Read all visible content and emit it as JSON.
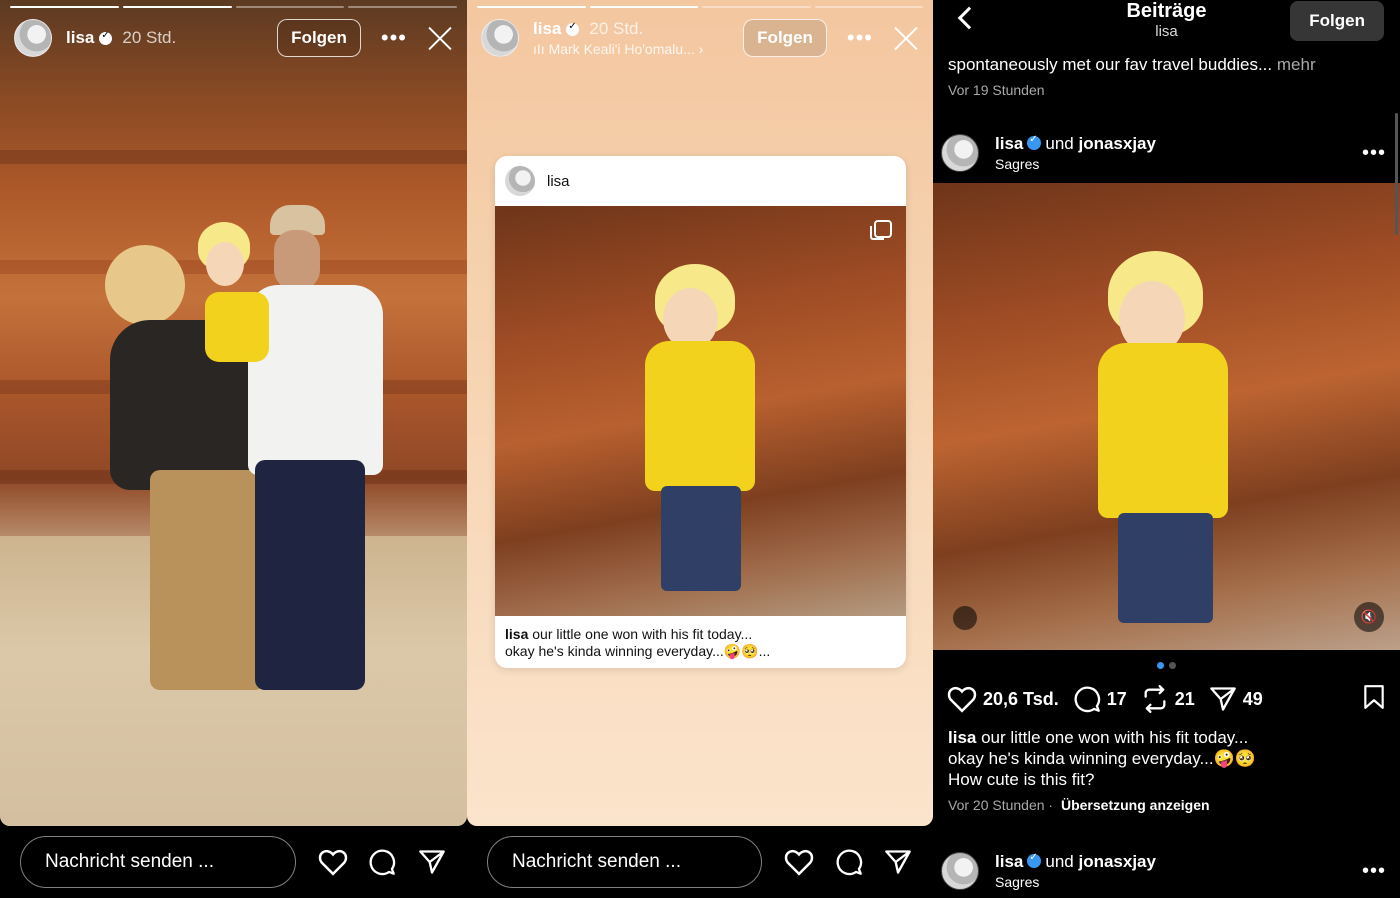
{
  "story1": {
    "username": "lisa",
    "time": "20 Std.",
    "follow_label": "Folgen",
    "more_icon": "more-dots-icon",
    "close_icon": "close-icon",
    "progress_segments": 4,
    "progress_done": 2
  },
  "story2": {
    "username": "lisa",
    "time": "20 Std.",
    "music": "Mark Keali'i Ho'omalu...",
    "follow_label": "Folgen",
    "card": {
      "username": "lisa",
      "caption_user": "lisa",
      "caption_text": "our little one won with his fit today...",
      "caption_line2": "okay he's kinda winning everyday...🤪🥺..."
    }
  },
  "bottom_bar": {
    "placeholder": "Nachricht senden ...",
    "icons": [
      "heart-icon",
      "comment-icon",
      "send-icon"
    ]
  },
  "feed": {
    "title": "Beiträge",
    "subtitle": "lisa",
    "follow_label": "Folgen",
    "prev_caption": "spontaneously met our fav travel buddies...",
    "prev_more": "mehr",
    "prev_time": "Vor 19 Stunden",
    "post": {
      "user1": "lisa",
      "connector": "und",
      "user2": "jonasxjay",
      "location": "Sagres",
      "likes": "20,6 Tsd.",
      "comments": "17",
      "reposts": "21",
      "shares": "49",
      "caption_user": "lisa",
      "caption_line1": "our little one won with his fit today...",
      "caption_line2": "okay he's kinda winning everyday...🤪🥺",
      "caption_line3": "How cute is this fit?",
      "time": "Vor 20 Stunden",
      "translate": "Übersetzung anzeigen"
    },
    "next_post": {
      "user1": "lisa",
      "connector": "und",
      "user2": "jonasxjay",
      "location": "Sagres"
    }
  },
  "colors": {
    "accent_blue": "#3897f0",
    "peach_bg": "#f6d3b0",
    "button_gray": "#363636"
  }
}
